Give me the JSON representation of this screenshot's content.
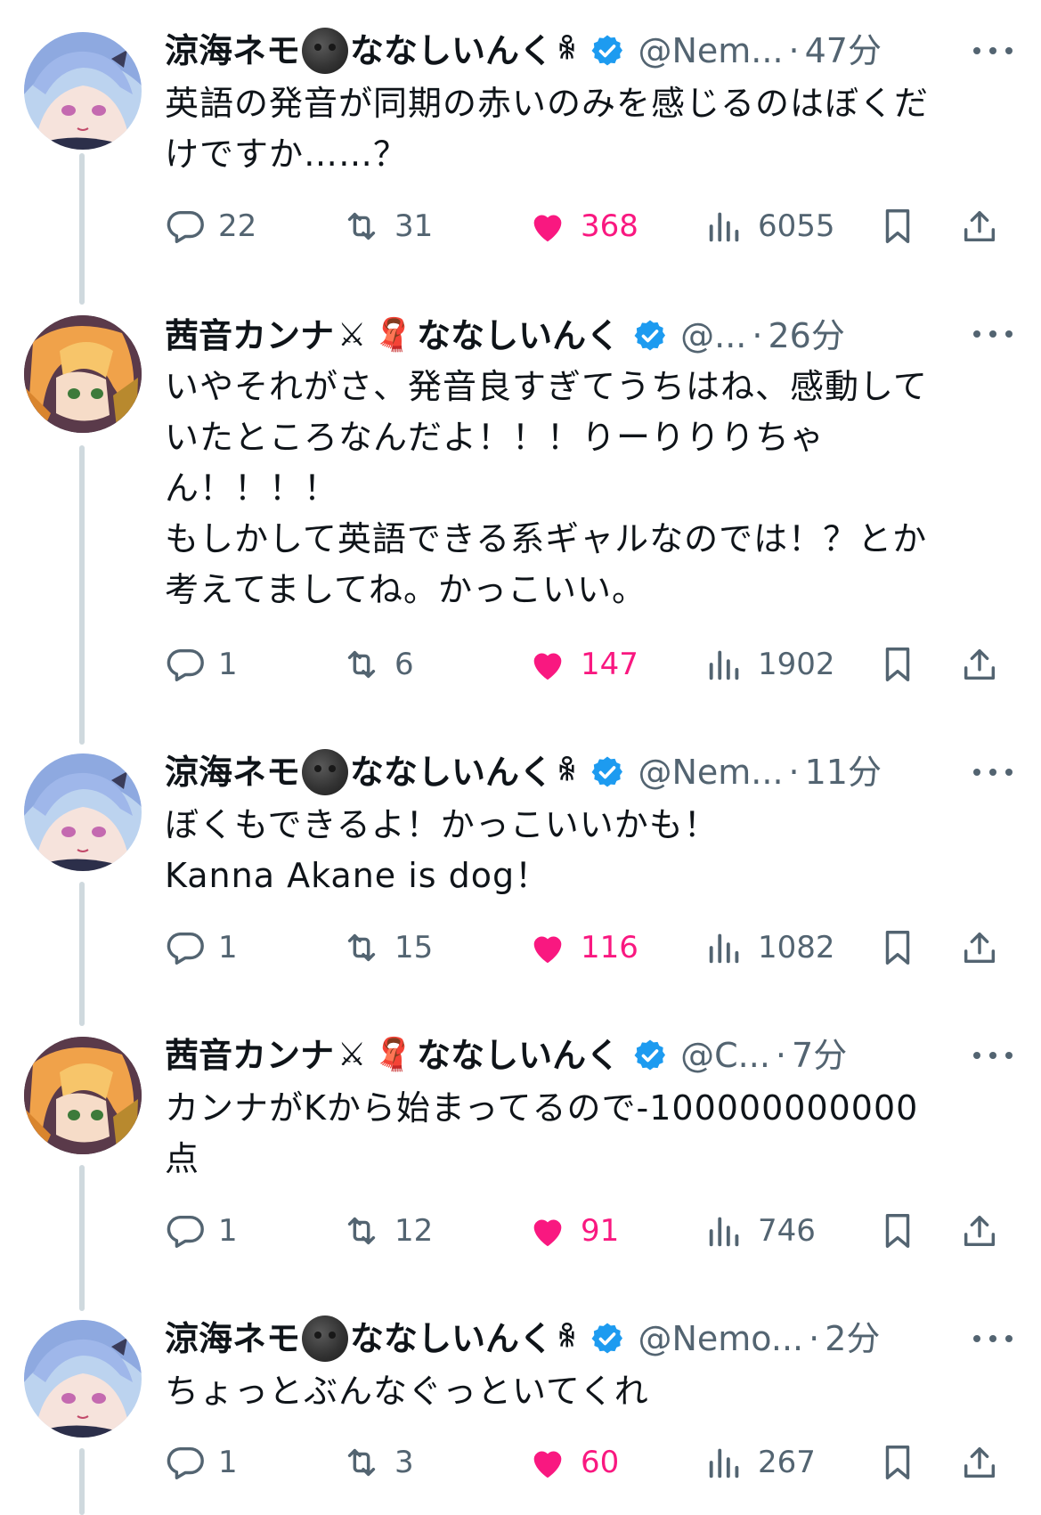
{
  "thread": {
    "tweets": [
      {
        "name": "涼海ネモ",
        "name_suffix": "ななしいんく",
        "handle": "@Nem...",
        "time": "47分",
        "text": "英語の発音が同期の赤いのみを感じるのはぼくだ\nけですか……？",
        "replies": "22",
        "retweets": "31",
        "likes": "368",
        "views": "6055",
        "avatar": "nemo"
      },
      {
        "name": "茜音カンナ",
        "name_suffix": "ななしいんく",
        "handle": "@...",
        "time": "26分",
        "text": "いやそれがさ、発音良すぎてうちはね、感動して\nいたところなんだよ！！！りーりりりちゃ\nん！！！！\nもしかして英語できる系ギャルなのでは！？とか\n考えてましてね。かっこいい。",
        "replies": "1",
        "retweets": "6",
        "likes": "147",
        "views": "1902",
        "avatar": "kanna"
      },
      {
        "name": "涼海ネモ",
        "name_suffix": "ななしいんく",
        "handle": "@Nem...",
        "time": "11分",
        "text": "ぼくもできるよ！かっこいいかも！\nKanna Akane is dog！",
        "replies": "1",
        "retweets": "15",
        "likes": "116",
        "views": "1082",
        "avatar": "nemo"
      },
      {
        "name": "茜音カンナ",
        "name_suffix": "ななしいんく",
        "handle": "@C...",
        "time": "7分",
        "text": "カンナがKから始まってるので-100000000000\n点",
        "replies": "1",
        "retweets": "12",
        "likes": "91",
        "views": "746",
        "avatar": "kanna"
      },
      {
        "name": "涼海ネモ",
        "name_suffix": "ななしいんく",
        "handle": "@Nemo...",
        "time": "2分",
        "text": "ちょっとぶんなぐっといてくれ",
        "replies": "1",
        "retweets": "3",
        "likes": "60",
        "views": "267",
        "avatar": "nemo"
      }
    ]
  },
  "colors": {
    "text": "#0f1419",
    "secondary": "#536471",
    "like": "#f91880",
    "verified": "#1d9bf0",
    "thread_line": "#cfd9de"
  },
  "icons": {
    "reply": "speech-bubble-icon",
    "retweet": "retweet-arrows-icon",
    "like": "heart-icon",
    "views": "bar-chart-icon",
    "bookmark": "bookmark-icon",
    "share": "share-upload-icon",
    "more": "more-dots-icon",
    "verified": "verified-badge-icon"
  }
}
